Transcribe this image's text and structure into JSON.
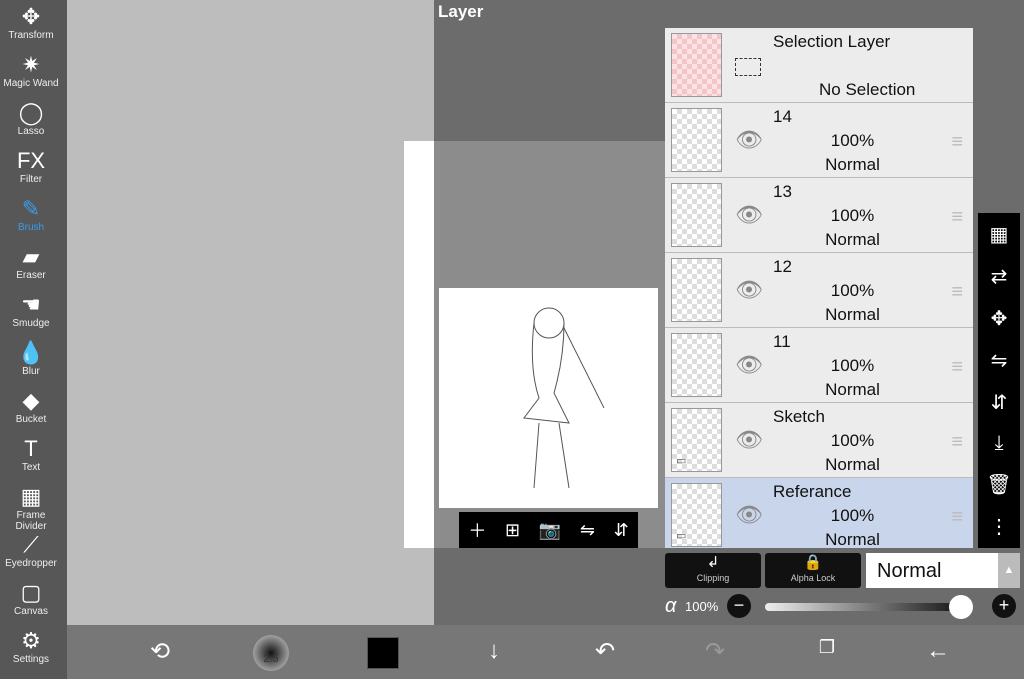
{
  "toolbar": {
    "items": [
      {
        "label": "Transform",
        "icon": "✥"
      },
      {
        "label": "Magic Wand",
        "icon": "✷"
      },
      {
        "label": "Lasso",
        "icon": "◯"
      },
      {
        "label": "Filter",
        "icon": "FX"
      },
      {
        "label": "Brush",
        "icon": "✎"
      },
      {
        "label": "Eraser",
        "icon": "▰"
      },
      {
        "label": "Smudge",
        "icon": "☚"
      },
      {
        "label": "Blur",
        "icon": "💧"
      },
      {
        "label": "Bucket",
        "icon": "◆"
      },
      {
        "label": "Text",
        "icon": "T"
      },
      {
        "label": "Frame Divider",
        "icon": "▦"
      },
      {
        "label": "Eyedropper",
        "icon": "⟋"
      },
      {
        "label": "Canvas",
        "icon": "▢"
      },
      {
        "label": "Settings",
        "icon": "⚙"
      }
    ],
    "active": "Brush",
    "accent": "#3d9be9"
  },
  "panel": {
    "title": "Layer",
    "selection_layer": {
      "name": "Selection Layer",
      "status": "No Selection"
    },
    "layers": [
      {
        "name": "14",
        "opacity": "100%",
        "mode": "Normal"
      },
      {
        "name": "13",
        "opacity": "100%",
        "mode": "Normal"
      },
      {
        "name": "12",
        "opacity": "100%",
        "mode": "Normal"
      },
      {
        "name": "11",
        "opacity": "100%",
        "mode": "Normal"
      },
      {
        "name": "Sketch",
        "opacity": "100%",
        "mode": "Normal",
        "folder": true
      },
      {
        "name": "Referance",
        "opacity": "100%",
        "mode": "Normal",
        "folder": true,
        "selected": true
      }
    ],
    "clipping_label": "Clipping",
    "alpha_lock_label": "Alpha Lock",
    "blend_mode": "Normal",
    "alpha_symbol": "α",
    "opacity": "100%",
    "opacity_value": 100
  },
  "bottombar": {
    "brush_size": "2.5",
    "color": "#000000"
  }
}
